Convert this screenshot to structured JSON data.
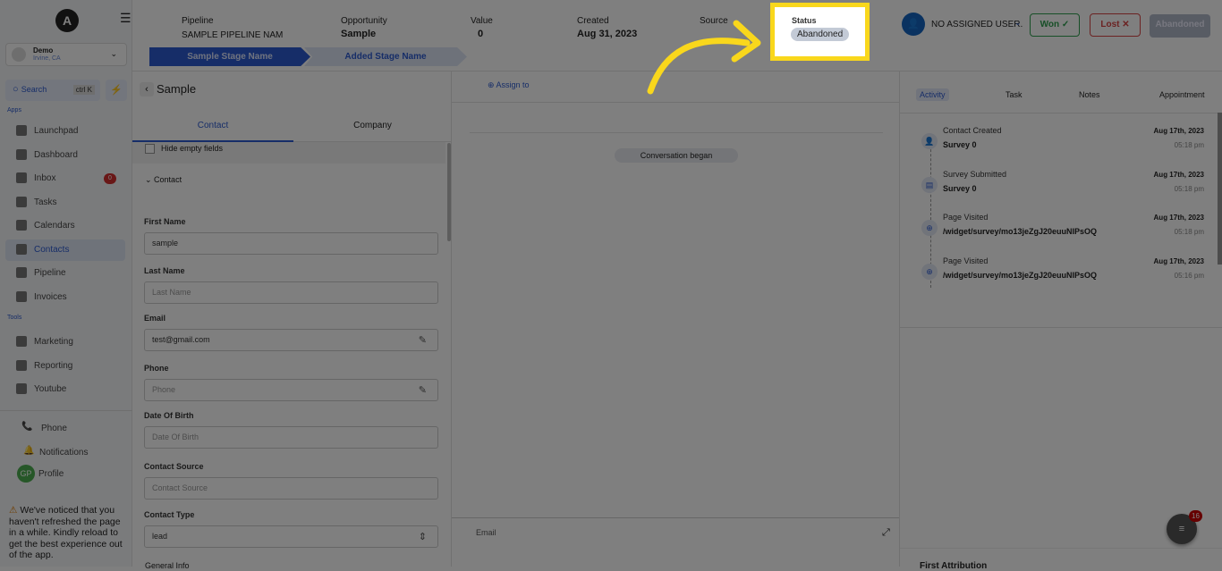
{
  "sidebar": {
    "logo": "A",
    "location": {
      "name": "Demo",
      "address": "Irvine, CA"
    },
    "search": {
      "label": "Search",
      "shortcut": "ctrl K"
    },
    "section_apps": "Apps",
    "section_tools": "Tools",
    "apps": [
      {
        "label": "Launchpad"
      },
      {
        "label": "Dashboard"
      },
      {
        "label": "Inbox",
        "badge": "0"
      },
      {
        "label": "Tasks"
      },
      {
        "label": "Calendars"
      },
      {
        "label": "Contacts",
        "active": true
      },
      {
        "label": "Pipeline"
      },
      {
        "label": "Invoices"
      }
    ],
    "tools": [
      {
        "label": "Marketing"
      },
      {
        "label": "Reporting"
      },
      {
        "label": "Youtube"
      }
    ],
    "bottom": {
      "phone": "Phone",
      "notifications": "Notifications",
      "profile": "Profile",
      "profile_initials": "GP"
    },
    "notice": "We've noticed that you haven't refreshed the page in a while. Kindly reload to get the best experience out of the app."
  },
  "header": {
    "pipeline_label": "Pipeline",
    "pipeline_value": "SAMPLE PIPELINE NAM",
    "opportunity_label": "Opportunity",
    "opportunity_value": "Sample",
    "value_label": "Value",
    "value_value": "0",
    "created_label": "Created",
    "created_value": "Aug 31, 2023",
    "source_label": "Source",
    "status_label": "Status",
    "status_value": "Abandoned",
    "stages": [
      "Sample Stage Name",
      "Added Stage Name"
    ],
    "assigned_user": "NO ASSIGNED USER.",
    "won": "Won",
    "lost": "Lost",
    "abandoned": "Abandoned"
  },
  "left": {
    "title": "Sample",
    "tabs": [
      "Contact",
      "Company"
    ],
    "hide_empty": "Hide empty fields",
    "section": "Contact",
    "fields": [
      {
        "label": "First Name",
        "value": "sample",
        "placeholder": ""
      },
      {
        "label": "Last Name",
        "value": "",
        "placeholder": "Last Name"
      },
      {
        "label": "Email",
        "value": "test@gmail.com",
        "placeholder": ""
      },
      {
        "label": "Phone",
        "value": "",
        "placeholder": "Phone"
      },
      {
        "label": "Date Of Birth",
        "value": "",
        "placeholder": "Date Of Birth"
      },
      {
        "label": "Contact Source",
        "value": "",
        "placeholder": "Contact Source"
      },
      {
        "label": "Contact Type",
        "value": "lead",
        "placeholder": ""
      }
    ],
    "next_section": "General Info"
  },
  "mid": {
    "assign": "Assign to",
    "conversation": "Conversation began",
    "composer_tab": "Email"
  },
  "right": {
    "tabs": [
      "Activity",
      "Task",
      "Notes",
      "Appointment"
    ],
    "activities": [
      {
        "title": "Contact Created",
        "sub": "Survey 0",
        "date": "Aug 17th, 2023",
        "time": "05:18 pm"
      },
      {
        "title": "Survey Submitted",
        "sub": "Survey 0",
        "date": "Aug 17th, 2023",
        "time": "05:18 pm"
      },
      {
        "title": "Page Visited",
        "sub": "/widget/survey/mo13jeZgJ20euuNIPsOQ",
        "date": "Aug 17th, 2023",
        "time": "05:18 pm"
      },
      {
        "title": "Page Visited",
        "sub": "/widget/survey/mo13jeZgJ20euuNIPsOQ",
        "date": "Aug 17th, 2023",
        "time": "05:16 pm"
      }
    ],
    "first_attribution": "First Attribution",
    "chat_badge": "16"
  },
  "colors": {
    "accent": "#2d5bd0",
    "highlight": "#f9d71c",
    "won": "#2e9e4f",
    "lost": "#d64545"
  }
}
